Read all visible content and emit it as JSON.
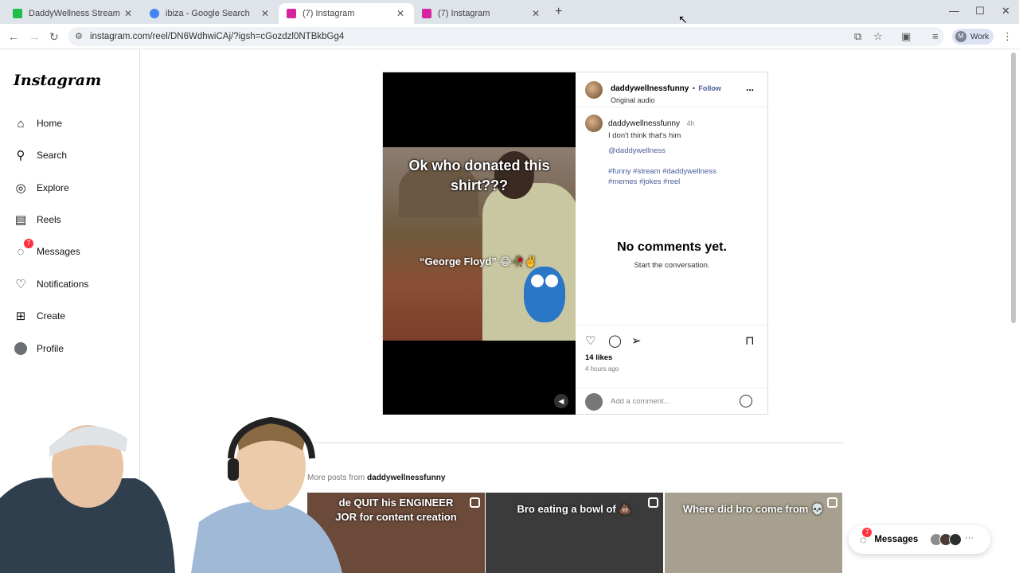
{
  "browser": {
    "tabs": [
      {
        "title": "DaddyWellness Stream - Watch",
        "favicon_color": "#1fbf4a",
        "active": false
      },
      {
        "title": "ibiza - Google Search",
        "favicon_color": "#4285f4",
        "active": false
      },
      {
        "title": "(7) Instagram",
        "favicon_color": "#d6249f",
        "active": true
      },
      {
        "title": "(7) Instagram",
        "favicon_color": "#d6249f",
        "active": false
      }
    ],
    "url": "instagram.com/reel/DN6WdhwiCAj/?igsh=cGozdzl0NTBkbGg4",
    "profile_initial": "M",
    "profile_label": "Work"
  },
  "sidebar": {
    "logo": "Instagram",
    "items": [
      {
        "label": "Home",
        "icon": "home-icon"
      },
      {
        "label": "Search",
        "icon": "search-icon"
      },
      {
        "label": "Explore",
        "icon": "compass-icon"
      },
      {
        "label": "Reels",
        "icon": "reels-icon"
      },
      {
        "label": "Messages",
        "icon": "messenger-icon",
        "badge": "7"
      },
      {
        "label": "Notifications",
        "icon": "heart-icon"
      },
      {
        "label": "Create",
        "icon": "plus-square-icon"
      },
      {
        "label": "Profile",
        "icon": "profile-avatar-icon"
      }
    ]
  },
  "post": {
    "video_caption_top": "Ok who donated this shirt???",
    "video_caption_mid": "“George Floyd” 😂🥀✌️",
    "author": "daddywellnessfunny",
    "follow_label": "Follow",
    "separator": "•",
    "audio": "Original audio",
    "caption_author": "daddywellnessfunny",
    "caption_time": "4h",
    "caption_text": "I don't think that's him",
    "mention": "@daddywellness",
    "hashtags_line1": "#funny #stream #daddywellness",
    "hashtags_line2": "#memes #jokes #reel",
    "no_comments_title": "No comments yet.",
    "no_comments_sub": "Start the conversation.",
    "likes": "14 likes",
    "posted_ago": "4 hours ago",
    "comment_placeholder": "Add a comment...",
    "more_menu": "..."
  },
  "more_posts": {
    "prefix": "More posts from",
    "author": "daddywellnessfunny",
    "thumbs": [
      {
        "caption": "de QUIT his ENGINEER\nJOR for content creation",
        "bg": "#6b4a3a"
      },
      {
        "caption": "Bro eating a bowl of 💩",
        "bg": "#3b3b3b"
      },
      {
        "caption": "Where did bro come from 💀",
        "bg": "#a7a08e"
      }
    ]
  },
  "messages_pill": {
    "label": "Messages",
    "badge": "7",
    "more": "···"
  },
  "colors": {
    "accent_blue": "#4a5d9a",
    "badge_red": "#ff3040"
  }
}
